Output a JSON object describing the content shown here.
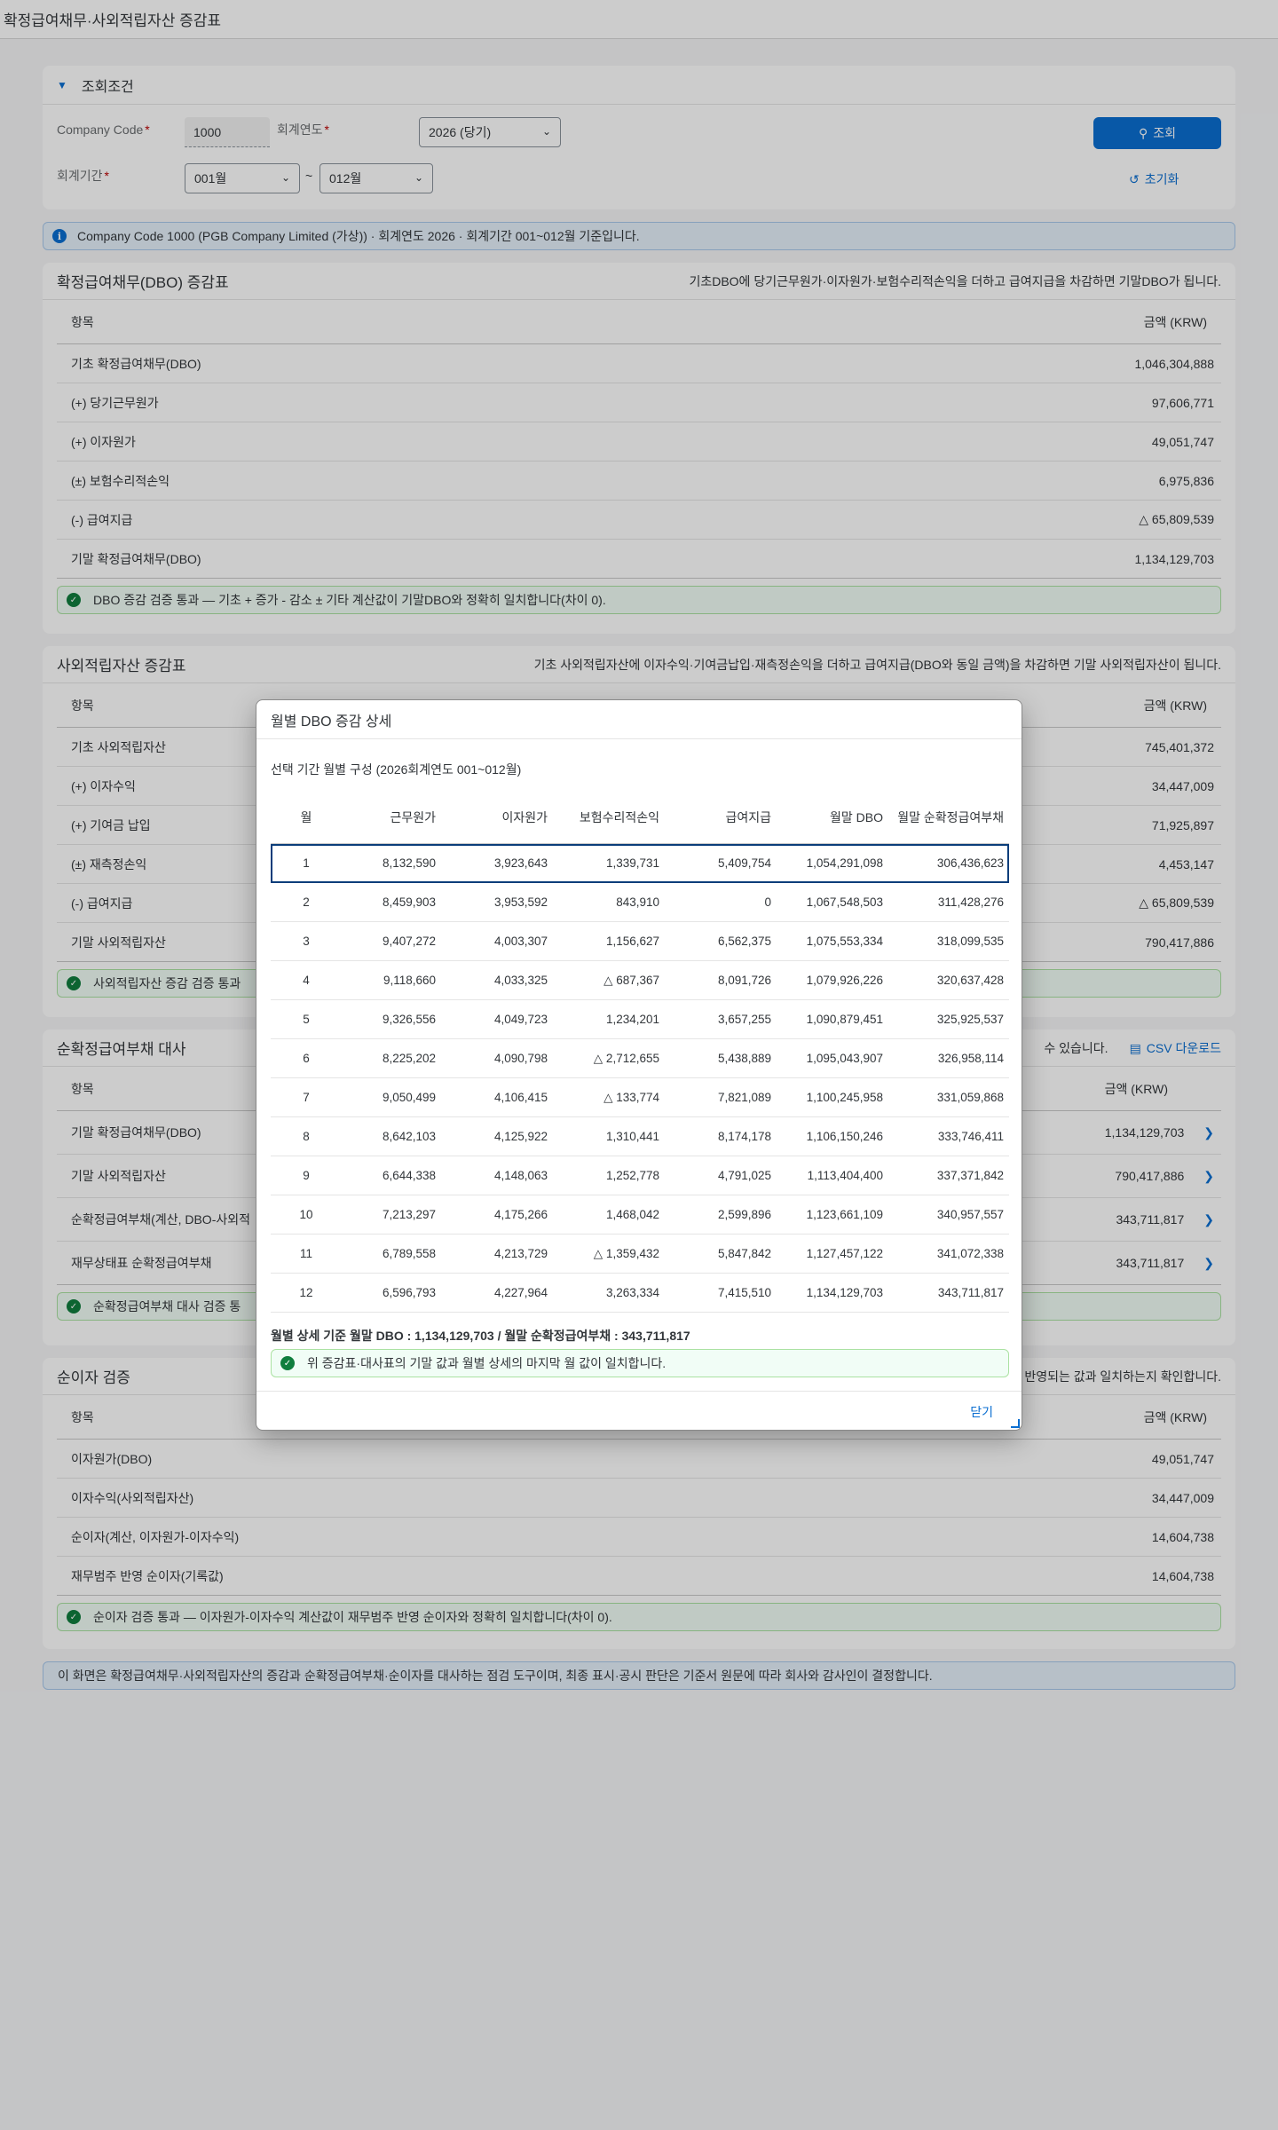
{
  "app": {
    "title": "확정급여채무·사외적립자산 증감표"
  },
  "filter": {
    "title": "조회조건",
    "company_code_label": "Company Code",
    "company_code_value": "1000",
    "fiscal_year_label": "회계연도",
    "fiscal_year_value": "2026 (당기)",
    "period_label": "회계기간",
    "period_from": "001월",
    "period_tilde": "~",
    "period_to": "012월",
    "search_label": "조회",
    "reset_label": "초기화"
  },
  "info_strip": "Company Code 1000 (PGB Company Limited (가상)) · 회계연도 2026 · 회계기간 001~012월 기준입니다.",
  "dbo": {
    "title": "확정급여채무(DBO) 증감표",
    "desc": "기초DBO에 당기근무원가·이자원가·보험수리적손익을 더하고 급여지급을 차감하면 기말DBO가 됩니다.",
    "col_item": "항목",
    "col_amount": "금액 (KRW)",
    "rows": [
      {
        "label": "기초 확정급여채무(DBO)",
        "value": "1,046,304,888"
      },
      {
        "label": "(+) 당기근무원가",
        "value": "97,606,771"
      },
      {
        "label": "(+) 이자원가",
        "value": "49,051,747"
      },
      {
        "label": "(±) 보험수리적손익",
        "value": "6,975,836"
      },
      {
        "label": "(-) 급여지급",
        "value": "△ 65,809,539"
      },
      {
        "label": "기말 확정급여채무(DBO)",
        "value": "1,134,129,703"
      }
    ],
    "success": "DBO 증감 검증 통과 — 기초 + 증가 - 감소 ± 기타 계산값이 기말DBO와 정확히 일치합니다(차이 0)."
  },
  "assets": {
    "title": "사외적립자산 증감표",
    "desc": "기초 사외적립자산에 이자수익·기여금납입·재측정손익을 더하고 급여지급(DBO와 동일 금액)을 차감하면 기말 사외적립자산이 됩니다.",
    "col_item": "항목",
    "col_amount": "금액 (KRW)",
    "rows": [
      {
        "label": "기초 사외적립자산",
        "value": "745,401,372"
      },
      {
        "label": "(+) 이자수익",
        "value": "34,447,009"
      },
      {
        "label": "(+) 기여금 납입",
        "value": "71,925,897"
      },
      {
        "label": "(±) 재측정손익",
        "value": "4,453,147"
      },
      {
        "label": "(-) 급여지급",
        "value": "△ 65,809,539"
      },
      {
        "label": "기말 사외적립자산",
        "value": "790,417,886"
      }
    ],
    "success": "사외적립자산 증감 검증 통과"
  },
  "net": {
    "title": "순확정급여부채 대사",
    "desc": "수 있습니다.",
    "csv_label": "CSV 다운로드",
    "col_item": "항목",
    "col_amount": "금액 (KRW)",
    "rows": [
      {
        "label": "기말 확정급여채무(DBO)",
        "value": "1,134,129,703"
      },
      {
        "label": "기말 사외적립자산",
        "value": "790,417,886"
      },
      {
        "label": "순확정급여부채(계산, DBO-사외적",
        "value": "343,711,817"
      },
      {
        "label": "재무상태표 순확정급여부채",
        "value": "343,711,817"
      }
    ],
    "success": "순확정급여부채 대사 검증 통"
  },
  "interest": {
    "title": "순이자 검증",
    "desc": "반영되는 값과 일치하는지 확인합니다.",
    "col_item": "항목",
    "col_amount": "금액 (KRW)",
    "rows": [
      {
        "label": "이자원가(DBO)",
        "value": "49,051,747"
      },
      {
        "label": "이자수익(사외적립자산)",
        "value": "34,447,009"
      },
      {
        "label": "순이자(계산, 이자원가-이자수익)",
        "value": "14,604,738"
      },
      {
        "label": "재무범주 반영 순이자(기록값)",
        "value": "14,604,738"
      }
    ],
    "success": "순이자 검증 통과 — 이자원가-이자수익 계산값이 재무범주 반영 순이자와 정확히 일치합니다(차이 0)."
  },
  "footer_note": "이 화면은 확정급여채무·사외적립자산의 증감과 순확정급여부채·순이자를 대사하는 점검 도구이며, 최종 표시·공시 판단은 기준서 원문에 따라 회사와 감사인이 결정합니다.",
  "dialog": {
    "title": "월별 DBO 증감 상세",
    "subtitle": "선택 기간 월별 구성 (2026회계연도 001~012월)",
    "columns": [
      "월",
      "근무원가",
      "이자원가",
      "보험수리적손익",
      "급여지급",
      "월말 DBO",
      "월말 순확정급여부채"
    ],
    "rows": [
      [
        "1",
        "8,132,590",
        "3,923,643",
        "1,339,731",
        "5,409,754",
        "1,054,291,098",
        "306,436,623"
      ],
      [
        "2",
        "8,459,903",
        "3,953,592",
        "843,910",
        "0",
        "1,067,548,503",
        "311,428,276"
      ],
      [
        "3",
        "9,407,272",
        "4,003,307",
        "1,156,627",
        "6,562,375",
        "1,075,553,334",
        "318,099,535"
      ],
      [
        "4",
        "9,118,660",
        "4,033,325",
        "△ 687,367",
        "8,091,726",
        "1,079,926,226",
        "320,637,428"
      ],
      [
        "5",
        "9,326,556",
        "4,049,723",
        "1,234,201",
        "3,657,255",
        "1,090,879,451",
        "325,925,537"
      ],
      [
        "6",
        "8,225,202",
        "4,090,798",
        "△ 2,712,655",
        "5,438,889",
        "1,095,043,907",
        "326,958,114"
      ],
      [
        "7",
        "9,050,499",
        "4,106,415",
        "△ 133,774",
        "7,821,089",
        "1,100,245,958",
        "331,059,868"
      ],
      [
        "8",
        "8,642,103",
        "4,125,922",
        "1,310,441",
        "8,174,178",
        "1,106,150,246",
        "333,746,411"
      ],
      [
        "9",
        "6,644,338",
        "4,148,063",
        "1,252,778",
        "4,791,025",
        "1,113,404,400",
        "337,371,842"
      ],
      [
        "10",
        "7,213,297",
        "4,175,266",
        "1,468,042",
        "2,599,896",
        "1,123,661,109",
        "340,957,557"
      ],
      [
        "11",
        "6,789,558",
        "4,213,729",
        "△ 1,359,432",
        "5,847,842",
        "1,127,457,122",
        "341,072,338"
      ],
      [
        "12",
        "6,596,793",
        "4,227,964",
        "3,263,334",
        "7,415,510",
        "1,134,129,703",
        "343,711,817"
      ]
    ],
    "summary": "월별 상세 기준 월말 DBO : 1,134,129,703 / 월말 순확정급여부채 : 343,711,817",
    "success": "위 증감표·대사표의 기말 값과 월별 상세의 마지막 월 값이 일치합니다.",
    "close_label": "닫기"
  }
}
